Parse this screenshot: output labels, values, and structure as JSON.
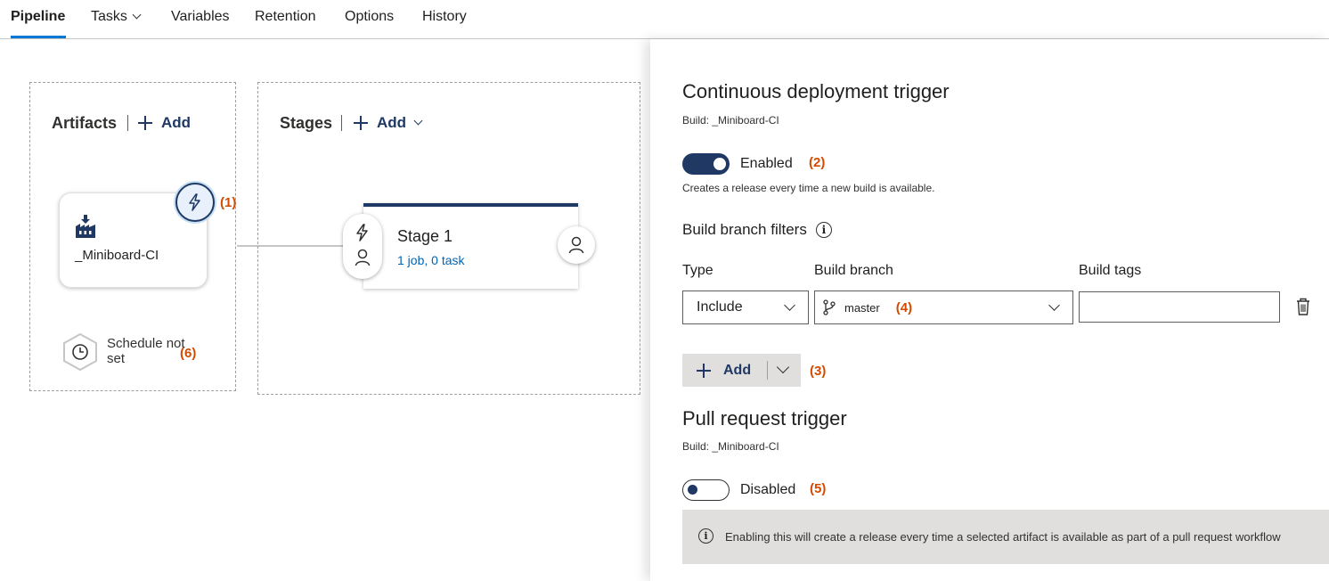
{
  "nav": {
    "tabs": [
      {
        "label": "Pipeline",
        "active": true
      },
      {
        "label": "Tasks",
        "has_dropdown": true
      },
      {
        "label": "Variables"
      },
      {
        "label": "Retention"
      },
      {
        "label": "Options"
      },
      {
        "label": "History"
      }
    ]
  },
  "artifacts": {
    "title": "Artifacts",
    "add_label": "Add",
    "artifact_name": "_Miniboard-CI",
    "trigger_annotation": "(1)",
    "schedule_label": "Schedule not set",
    "schedule_annotation": "(6)"
  },
  "stages": {
    "title": "Stages",
    "add_label": "Add",
    "stage": {
      "name": "Stage 1",
      "summary": "1 job, 0 task"
    }
  },
  "panel": {
    "cd_trigger": {
      "title": "Continuous deployment trigger",
      "build_label": "Build: _Miniboard-CI",
      "toggle_state": "Enabled",
      "toggle_annotation": "(2)",
      "description": "Creates a release every time a new build is available."
    },
    "branch_filters": {
      "title": "Build branch filters",
      "columns": {
        "type": "Type",
        "branch": "Build branch",
        "tags": "Build tags"
      },
      "row": {
        "type": "Include",
        "branch": "master",
        "branch_annotation": "(4)",
        "tags": ""
      },
      "add_label": "Add",
      "add_annotation": "(3)"
    },
    "pr_trigger": {
      "title": "Pull request trigger",
      "build_label": "Build: _Miniboard-CI",
      "toggle_state": "Disabled",
      "toggle_annotation": "(5)",
      "info": "Enabling this will create a release every time a selected artifact is available as part of a pull request workflow"
    }
  },
  "colors": {
    "accent": "#1f3864",
    "annotation": "#d34a00",
    "link": "#0064b4"
  }
}
